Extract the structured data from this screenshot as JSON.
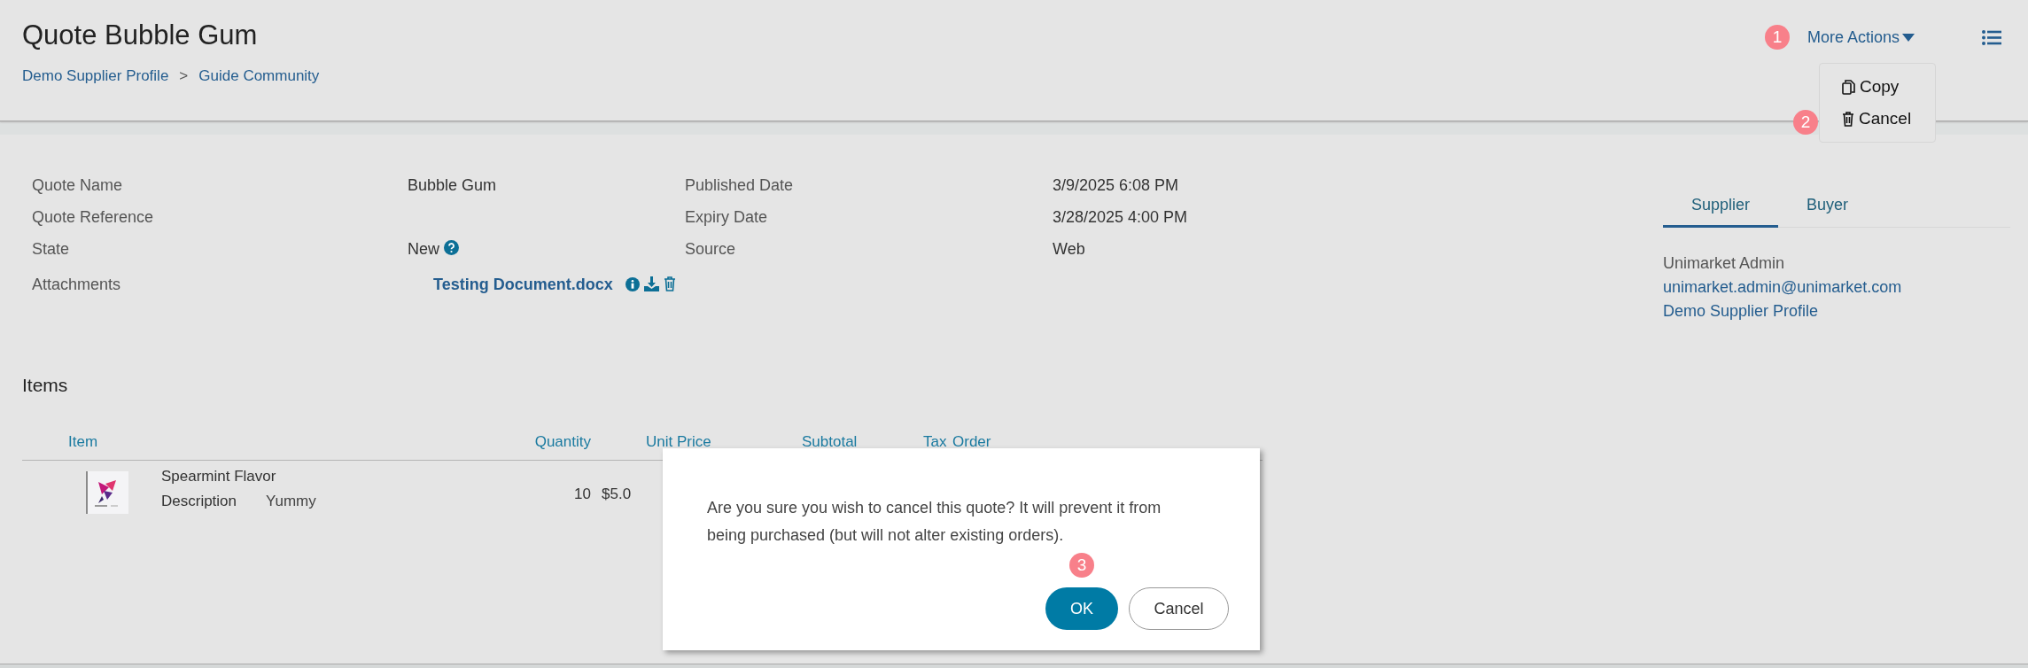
{
  "header": {
    "title": "Quote Bubble Gum",
    "breadcrumb": [
      "Demo Supplier Profile",
      "Guide Community"
    ],
    "separator": ">",
    "more_actions": "More Actions",
    "menu": [
      {
        "label": "Copy",
        "kind": "copy"
      },
      {
        "label": "Cancel",
        "kind": "delete"
      }
    ]
  },
  "steps": [
    "1",
    "2",
    "3"
  ],
  "details": [
    {
      "label": "Quote Name",
      "value": "Bubble Gum",
      "kind": "text"
    },
    {
      "label": "Quote Reference",
      "kind": "text"
    },
    {
      "label": "State",
      "value": "New",
      "kind": "state"
    },
    {
      "label": "Attachments",
      "value": "Testing Document.docx",
      "kind": "attachment"
    }
  ],
  "dates": [
    {
      "label": "Published Date",
      "value": "3/9/2025 6:08 PM"
    },
    {
      "label": "Expiry Date",
      "value": "3/28/2025 4:00 PM"
    },
    {
      "label": "Source",
      "value": "Web"
    }
  ],
  "party": {
    "tabs": [
      {
        "label": "Supplier",
        "selected": true
      },
      {
        "label": "Buyer",
        "selected": false
      }
    ],
    "name": "Unimarket Admin",
    "email": "unimarket.admin@unimarket.com",
    "organization": "Demo Supplier Profile"
  },
  "items": {
    "title": "Items",
    "columns": [
      "Item",
      "Quantity",
      "Unit Price",
      "Subtotal",
      "Tax",
      "Order"
    ],
    "rows": [
      {
        "name": "Spearmint Flavor",
        "description_label": "Description",
        "description": "Yummy",
        "quantity": "10",
        "unit_price": "$5.0"
      }
    ]
  },
  "dialog": {
    "message": "Are you sure you wish to cancel this quote? It will prevent it from being purchased (but will not alter existing orders).",
    "buttons": [
      {
        "label": "OK",
        "kind": "primary"
      },
      {
        "label": "Cancel",
        "kind": "secondary"
      }
    ]
  }
}
